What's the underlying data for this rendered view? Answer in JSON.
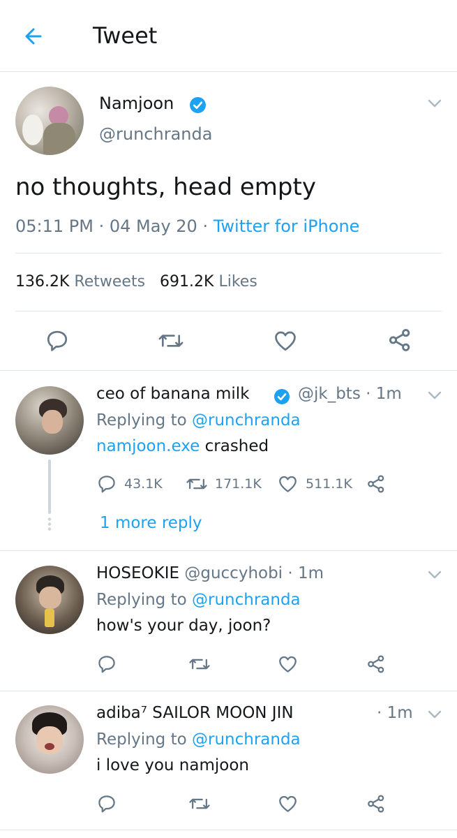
{
  "header": {
    "title": "Tweet"
  },
  "tweet": {
    "display_name": "Namjoon",
    "handle": "@runchranda",
    "text": "no thoughts, head empty",
    "time": "05:11 PM",
    "date": "04 May 20",
    "source": "Twitter for iPhone",
    "retweets_count": "136.2K",
    "retweets_label": "Retweets",
    "likes_count": "691.2K",
    "likes_label": "Likes"
  },
  "replies": [
    {
      "display_name": "ceo of banana milk",
      "handle": "@jk_bts",
      "time": "1m",
      "replying_prefix": "Replying to",
      "replying_to": "@runchranda",
      "text_link": "namjoon.exe",
      "text": "crashed",
      "reply_count": "43.1K",
      "retweet_count": "171.1K",
      "like_count": "511.1K",
      "more_replies": "1 more reply"
    },
    {
      "display_name": "HOSEOKIE",
      "handle": "@guccyhobi",
      "time": "1m",
      "replying_prefix": "Replying to",
      "replying_to": "@runchranda",
      "text": "how's your day, joon?"
    },
    {
      "display_name": "adiba⁷ SAILOR MOON JIN",
      "time": "1m",
      "replying_prefix": "Replying to",
      "replying_to": "@runchranda",
      "text": "i love you namjoon"
    }
  ],
  "colors": {
    "accent": "#1da1f2",
    "secondary_text": "#657786",
    "divider": "#e1e8ed"
  },
  "icons": [
    "back-arrow-icon",
    "verified-badge-icon",
    "chevron-down-icon",
    "reply-icon",
    "retweet-icon",
    "like-icon",
    "share-icon"
  ]
}
